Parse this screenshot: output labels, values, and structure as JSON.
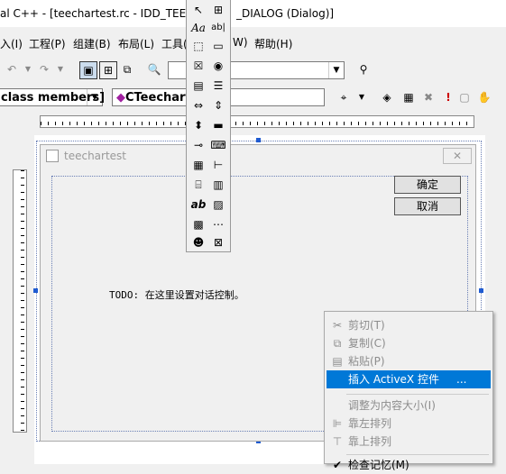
{
  "window": {
    "title": "al C++ - [teechartest.rc - IDD_TEECH",
    "title_suffix": "_DIALOG (Dialog)]"
  },
  "menu": {
    "items": [
      {
        "label": "入(I)"
      },
      {
        "label": "工程(P)"
      },
      {
        "label": "组建(B)"
      },
      {
        "label": "布局(L)"
      },
      {
        "label": "工具("
      },
      {
        "label": "W)"
      },
      {
        "label": "帮助(H)"
      }
    ]
  },
  "toolbar2": {
    "class_combo": "class members]",
    "member_combo": "CTeechart"
  },
  "toolbox_icons": [
    "pointer-icon",
    "picture-icon",
    "static-text-icon",
    "edit-box-icon",
    "group-box-icon",
    "button-icon",
    "checkbox-icon",
    "radio-icon",
    "combo-box-icon",
    "list-box-icon",
    "hscroll-icon",
    "vscroll-icon",
    "spin-icon",
    "progress-icon",
    "slider-icon",
    "hotkey-icon",
    "list-control-icon",
    "tree-control-icon",
    "tab-control-icon",
    "animate-icon",
    "rich-edit-icon",
    "date-picker-icon",
    "month-calendar-icon",
    "ip-address-icon",
    "custom-control-icon",
    "combo-ex-icon"
  ],
  "dialog": {
    "caption": "teechartest",
    "ok_label": "确定",
    "cancel_label": "取消",
    "todo_text": "TODO: 在这里设置对话控制。"
  },
  "context_menu": {
    "cut": "剪切(T)",
    "copy": "复制(C)",
    "paste": "粘贴(P)",
    "insert_activex": "插入 ActiveX 控件",
    "insert_activex_ellipsis": "...",
    "size_to_content": "调整为内容大小(I)",
    "align_left": "靠左排列",
    "align_top": "靠上排列",
    "check_mnemonics": "检查记忆(M)"
  },
  "colors": {
    "highlight": "#0078d7",
    "selection_handle": "#1f5bd1",
    "disabled_text": "#8d8d8d"
  }
}
